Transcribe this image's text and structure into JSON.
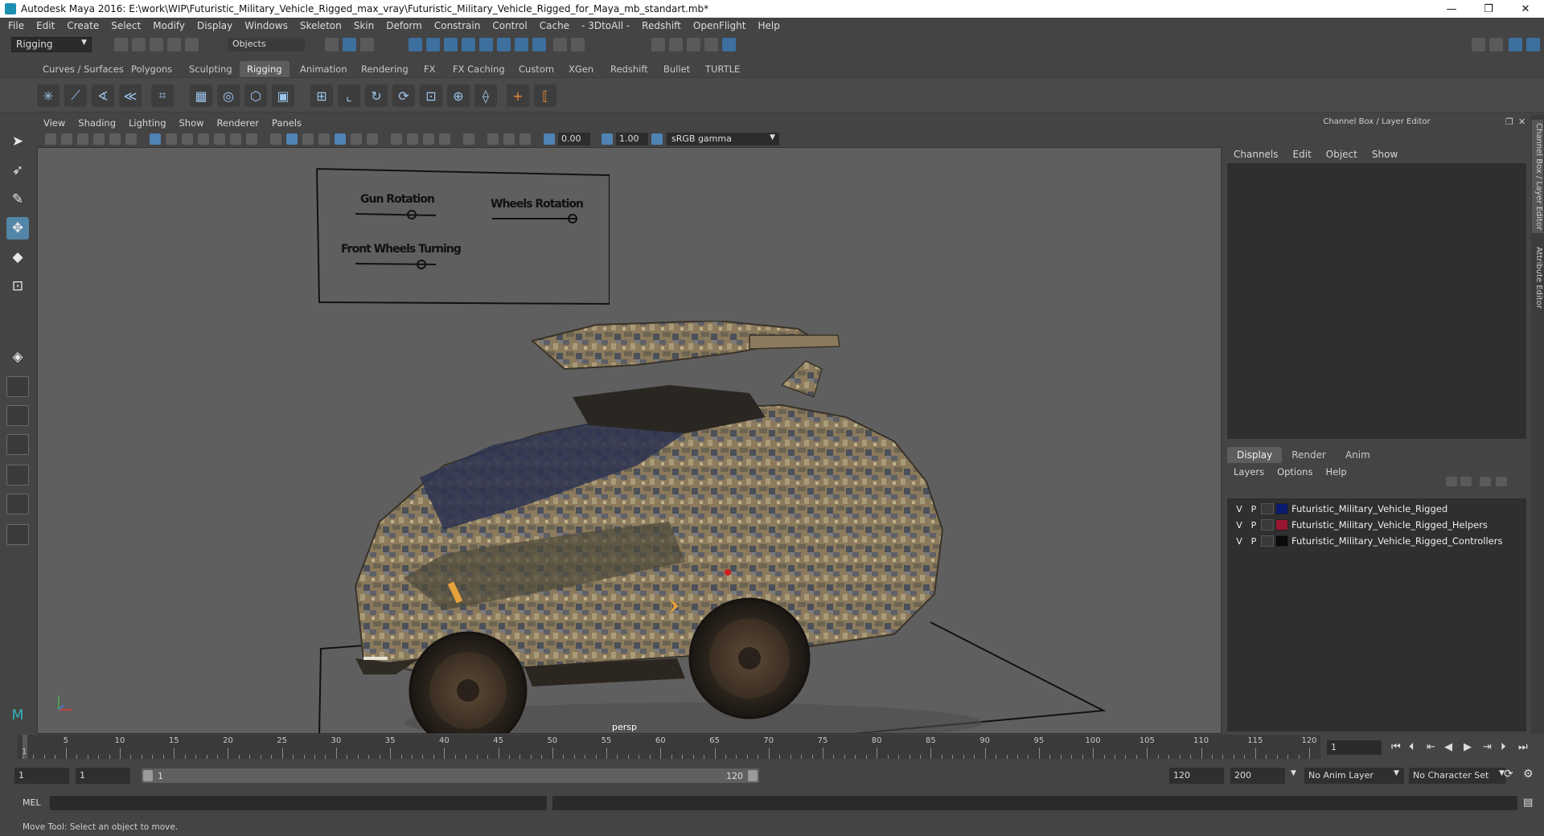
{
  "window": {
    "title": "Autodesk Maya 2016: E:\\work\\WIP\\Futuristic_Military_Vehicle_Rigged_max_vray\\Futuristic_Military_Vehicle_Rigged_for_Maya_mb_standart.mb*",
    "minimize": "—",
    "restore": "❐",
    "close": "✕"
  },
  "menu": [
    "File",
    "Edit",
    "Create",
    "Select",
    "Modify",
    "Display",
    "Windows",
    "Skeleton",
    "Skin",
    "Deform",
    "Constrain",
    "Control",
    "Cache",
    "- 3DtoAll -",
    "Redshift",
    "OpenFlight",
    "Help"
  ],
  "status_line": {
    "mode": "Rigging",
    "object_mode": "Objects"
  },
  "shelf_tabs": [
    "Curves / Surfaces",
    "Polygons",
    "Sculpting",
    "Rigging",
    "Animation",
    "Rendering",
    "FX",
    "FX Caching",
    "Custom",
    "XGen",
    "Redshift",
    "Bullet",
    "TURTLE"
  ],
  "shelf_active": "Rigging",
  "viewport": {
    "menu": [
      "View",
      "Shading",
      "Lighting",
      "Show",
      "Renderer",
      "Panels"
    ],
    "exposure": "0.00",
    "gamma": "1.00",
    "color_space": "sRGB gamma",
    "camera_label": "persp",
    "controls": {
      "gun_rotation": "Gun Rotation",
      "wheels_rotation": "Wheels Rotation",
      "front_wheels_turning": "Front Wheels Turning"
    }
  },
  "right_panel": {
    "header": "Channel Box / Layer Editor",
    "channel_menu": [
      "Channels",
      "Edit",
      "Object",
      "Show"
    ],
    "layer_tabs": [
      "Display",
      "Render",
      "Anim"
    ],
    "layer_tab_active": "Display",
    "layer_menu": [
      "Layers",
      "Options",
      "Help"
    ],
    "layers": [
      {
        "v": "V",
        "p": "P",
        "color": "#0a1a6e",
        "name": "Futuristic_Military_Vehicle_Rigged"
      },
      {
        "v": "V",
        "p": "P",
        "color": "#9b1631",
        "name": "Futuristic_Military_Vehicle_Rigged_Helpers"
      },
      {
        "v": "V",
        "p": "P",
        "color": "#0a0a0a",
        "name": "Futuristic_Military_Vehicle_Rigged_Controllers"
      }
    ],
    "side_tabs": [
      "Channel Box / Layer Editor",
      "Attribute Editor"
    ]
  },
  "timeline": {
    "ticks": [
      "5",
      "10",
      "15",
      "20",
      "25",
      "30",
      "35",
      "40",
      "45",
      "50",
      "55",
      "60",
      "65",
      "70",
      "75",
      "80",
      "85",
      "90",
      "95",
      "100",
      "105",
      "110",
      "115",
      "120"
    ],
    "first_frame": "1",
    "start": 1,
    "end": 120,
    "current_frame": "1"
  },
  "range": {
    "start_field": "1",
    "playback_start": "1",
    "slider_start": "1",
    "slider_end": "120",
    "playback_end": "120",
    "end_field": "200",
    "anim_layer": "No Anim Layer",
    "character_set": "No Character Set"
  },
  "command_line": {
    "label": "MEL"
  },
  "help_line": "Move Tool: Select an object to move."
}
